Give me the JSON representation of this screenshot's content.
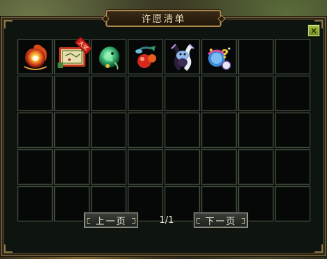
{
  "window": {
    "title": "许愿清单",
    "close_label": "×"
  },
  "items": [
    {
      "icon": "fire-orb-icon",
      "badge": ""
    },
    {
      "icon": "scroll-map-icon",
      "badge": "大奖"
    },
    {
      "icon": "jade-dragon-icon",
      "badge": ""
    },
    {
      "icon": "spirit-fruit-icon",
      "badge": ""
    },
    {
      "icon": "twin-fish-mount-icon",
      "badge": ""
    },
    {
      "icon": "mystery-gift-icon",
      "badge": ""
    }
  ],
  "grid": {
    "columns": 8,
    "rows": 5,
    "total_slots": 40
  },
  "pager": {
    "prev_label": "上一页",
    "next_label": "下一页",
    "page_indicator": "1/1"
  },
  "colors": {
    "title_text": "#f3e1b4",
    "frame_gold": "#a88a50",
    "slot_bg": "#050806",
    "close_green": "#8aa82f",
    "badge_red": "#c81e1e"
  }
}
